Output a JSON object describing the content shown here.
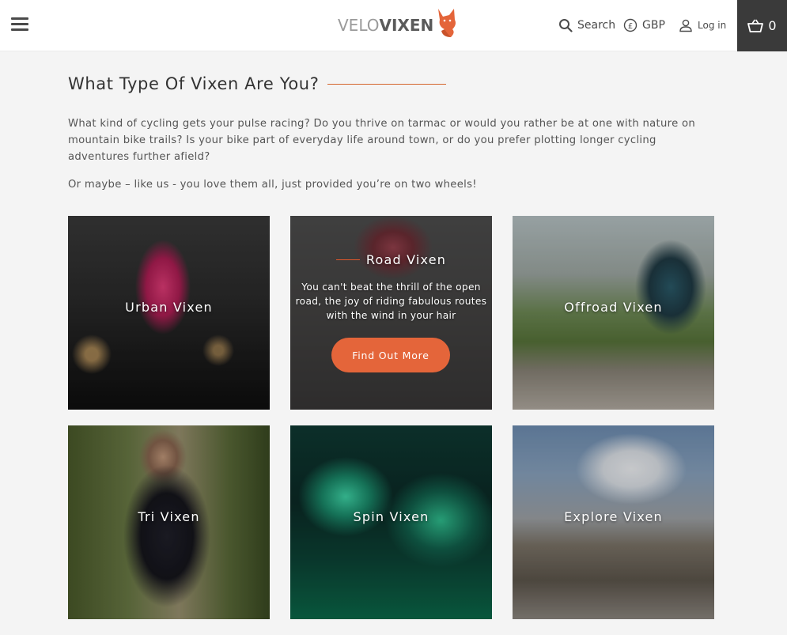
{
  "header": {
    "logo_velo": "VELO",
    "logo_vixen": "VIXEN",
    "search_label": "Search",
    "currency_label": "GBP",
    "login_label": "Log in",
    "basket_count": "0"
  },
  "section": {
    "title": "What Type Of Vixen Are You?",
    "intro_1": "What kind of cycling gets your pulse racing? Do you thrive on tarmac or would you rather be at one with nature on mountain bike trails? Is your bike part of everyday life around town, or do you prefer plotting longer cycling adventures further afield?",
    "intro_2": "Or maybe – like us - you love them all, just provided you’re on two wheels!"
  },
  "tiles": [
    {
      "label": "Urban Vixen"
    },
    {
      "label": "Road Vixen",
      "description": "You can't beat the thrill of the open road, the joy of riding fabulous routes with the wind in your hair",
      "button": "Find Out More"
    },
    {
      "label": "Offroad Vixen"
    },
    {
      "label": "Tri Vixen"
    },
    {
      "label": "Spin Vixen"
    },
    {
      "label": "Explore Vixen"
    }
  ],
  "colors": {
    "accent": "#e4653a",
    "header_bg": "#ffffff",
    "basket_bg": "#3a3a3a",
    "page_bg": "#f4f4f4"
  }
}
